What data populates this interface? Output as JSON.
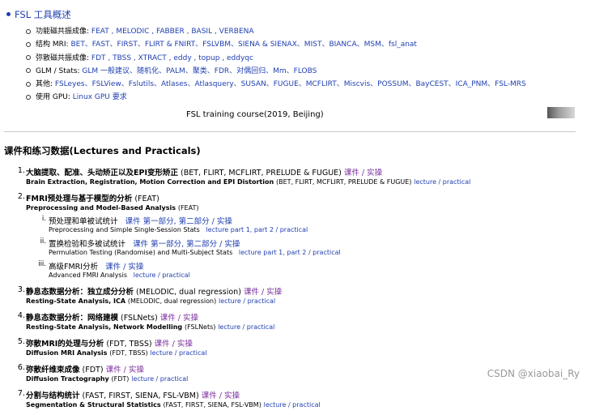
{
  "overview": {
    "title": "FSL 工具概述",
    "rows": [
      {
        "label": "功能磁共振成像:",
        "links": "FEAT , MELODIC , FABBER , BASIL , VERBENA"
      },
      {
        "label": "结构 MRI:",
        "links": "BET、FAST、FIRST、FLIRT & FNIRT、FSLVBM、SIENA & SIENAX、MIST、BIANCA、MSM、fsl_anat"
      },
      {
        "label": "弥散磁共振成像:",
        "links": "FDT , TBSS , XTRACT , eddy , topup , eddyqc"
      },
      {
        "label": "GLM / Stats:",
        "links": "GLM 一般建议、随机化、PALM、聚类、FDR、对偶回归、Mm、FLOBS"
      },
      {
        "label": "其他:",
        "links": "FSLeyes、FSLView、Fslutils、Atlases、Atlasquery、SUSAN、FUGUE、MCFLIRT、Miscvis、POSSUM、BayCEST、ICA_PNM、FSL-MRS"
      },
      {
        "label": "使用 GPU:",
        "links": "Linux GPU 要求"
      }
    ]
  },
  "course_caption": "FSL training course(2019, Beijing)",
  "section_title": "课件和练习数据(Lectures and Practicals)",
  "lectures": [
    {
      "num": "1.",
      "zh": "大脑提取、配准、头动矫正以及EPI变形矫正",
      "zh_note": "(BET, FLIRT, MCFLIRT, PRELUDE & FUGUE)",
      "zh_links": "课件 / 实操",
      "en": "Brain Extraction, Registration, Motion Correction and EPI Distortion",
      "en_note": "(BET, FLIRT, MCFLIRT, PRELUDE & FUGUE)",
      "en_links": "lecture / practical"
    },
    {
      "num": "2.",
      "zh": "FMRI预处理与基于模型的分析",
      "zh_note": "(FEAT)",
      "zh_links": "",
      "en": "Preprocessing and Model-Based Analysis",
      "en_note": "(FEAT)",
      "en_links": ""
    },
    {
      "num": "3.",
      "zh": "静息态数据分析：独立成分分析",
      "zh_note": "(MELODIC, dual regression)",
      "zh_links": "课件 / 实操",
      "en": "Resting-State Analysis, ICA",
      "en_note": "(MELODIC, dual regression)",
      "en_links": "lecture / practical"
    },
    {
      "num": "4.",
      "zh": "静息态数据分析：网络建模",
      "zh_note": "(FSLNets)",
      "zh_links": "课件 / 实操",
      "en": "Resting-State Analysis, Network Modelling",
      "en_note": "(FSLNets)",
      "en_links": "lecture / practical"
    },
    {
      "num": "5.",
      "zh": "弥散MRI的处理与分析",
      "zh_note": "(FDT, TBSS)",
      "zh_links": "课件 / 实操",
      "en": "Diffusion MRI Analysis",
      "en_note": "(FDT, TBSS)",
      "en_links": "lecture / practical"
    },
    {
      "num": "6.",
      "zh": "弥散纤维束成像",
      "zh_note": "(FDT)",
      "zh_links": "课件 / 实操",
      "en": "Diffusion Tractography",
      "en_note": "(FDT)",
      "en_links": "lecture / practical"
    },
    {
      "num": "7.",
      "zh": "分割与结构统计",
      "zh_note": "(FAST, FIRST, SIENA, FSL-VBM)",
      "zh_links": "课件 / 实操",
      "en": "Segmentation & Structural Statistics",
      "en_note": "(FAST, FIRST, SIENA, FSL-VBM)",
      "en_links": "lecture / practical"
    }
  ],
  "fmri_sub": [
    {
      "num": "i.",
      "zh": "预处理和单被试统计",
      "zh_links": "课件 第一部分, 第二部分 / 实操",
      "en": "Preprocessing and Simple Single-Session Stats",
      "en_links": "lecture part 1, part 2 / practical"
    },
    {
      "num": "ii.",
      "zh": "置换检验和多被试统计",
      "zh_links": "课件 第一部分, 第二部分 / 实操",
      "en": "Permulation Testing (Randomise) and Multi-Subject Stats",
      "en_links": "lecture part 1, part 2 / practical"
    },
    {
      "num": "iii.",
      "zh": "高级FMRI分析",
      "zh_links": "课件 / 实操",
      "en": "Advanced FMRI Analysis",
      "en_links": "lecture / practical"
    }
  ],
  "watermark": "CSDN @xiaobai_Ry"
}
